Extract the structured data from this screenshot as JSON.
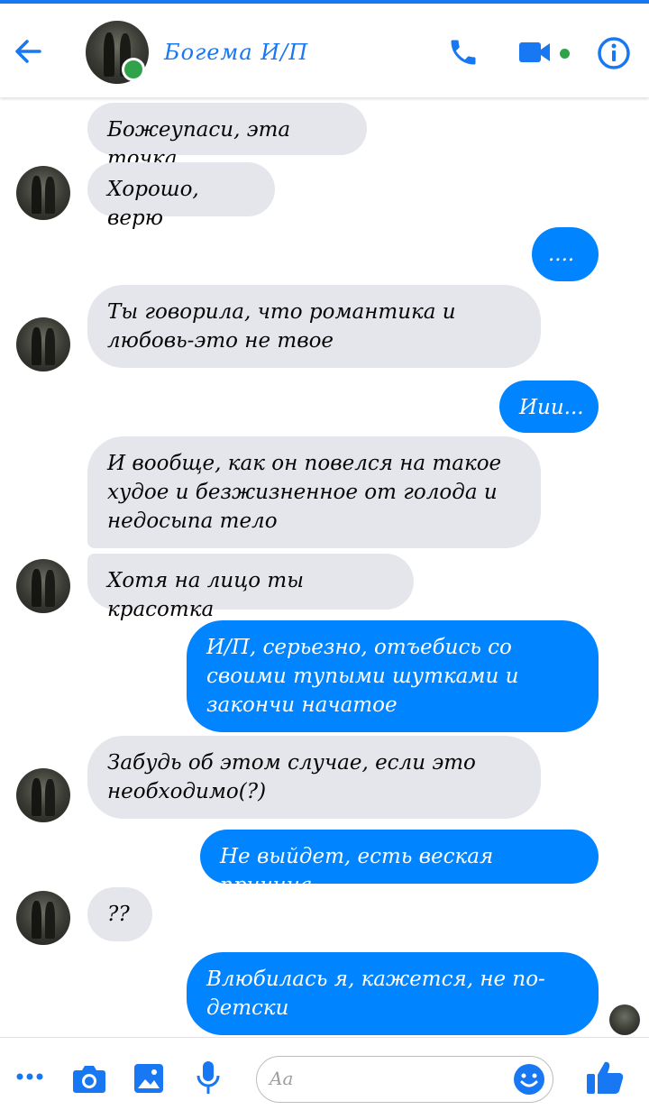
{
  "header": {
    "title": "Богема И/П",
    "accent": "#1877f2",
    "online_color": "#31a24c",
    "icons": [
      "back-arrow-icon",
      "phone-icon",
      "video-call-icon",
      "info-icon"
    ]
  },
  "messages": [
    {
      "side": "in",
      "text": "Божеупаси, эта точка"
    },
    {
      "side": "in",
      "text": "Хорошо, верю"
    },
    {
      "side": "out",
      "text": "...."
    },
    {
      "side": "in",
      "text": "Ты говорила, что романтика и\nлюбовь-это не твое"
    },
    {
      "side": "out",
      "text": "Иии..."
    },
    {
      "side": "in",
      "text": "И вообще, как он повелся на такое\nхудое и безжизненное от голода и\nнедосыпа тело"
    },
    {
      "side": "in",
      "text": "Хотя на лицо ты красотка"
    },
    {
      "side": "out",
      "text": "И/П, серьезно, отъебись со\nсвоими тупыми шутками и\nзакончи начатое"
    },
    {
      "side": "in",
      "text": "Забудь об этом случае, если это\nнеобходимо(?)"
    },
    {
      "side": "out",
      "text": "Не выйдет, есть веская причина"
    },
    {
      "side": "in",
      "text": "??"
    },
    {
      "side": "out",
      "text": "Влюбилась я, кажется, не по-\nдетски"
    }
  ],
  "composer": {
    "placeholder": "Aa",
    "icons": [
      "more-icon",
      "camera-icon",
      "gallery-icon",
      "microphone-icon",
      "emoji-icon",
      "like-icon"
    ]
  },
  "colors": {
    "incoming_bubble": "#e4e6eb",
    "outgoing_bubble": "#0084ff"
  }
}
